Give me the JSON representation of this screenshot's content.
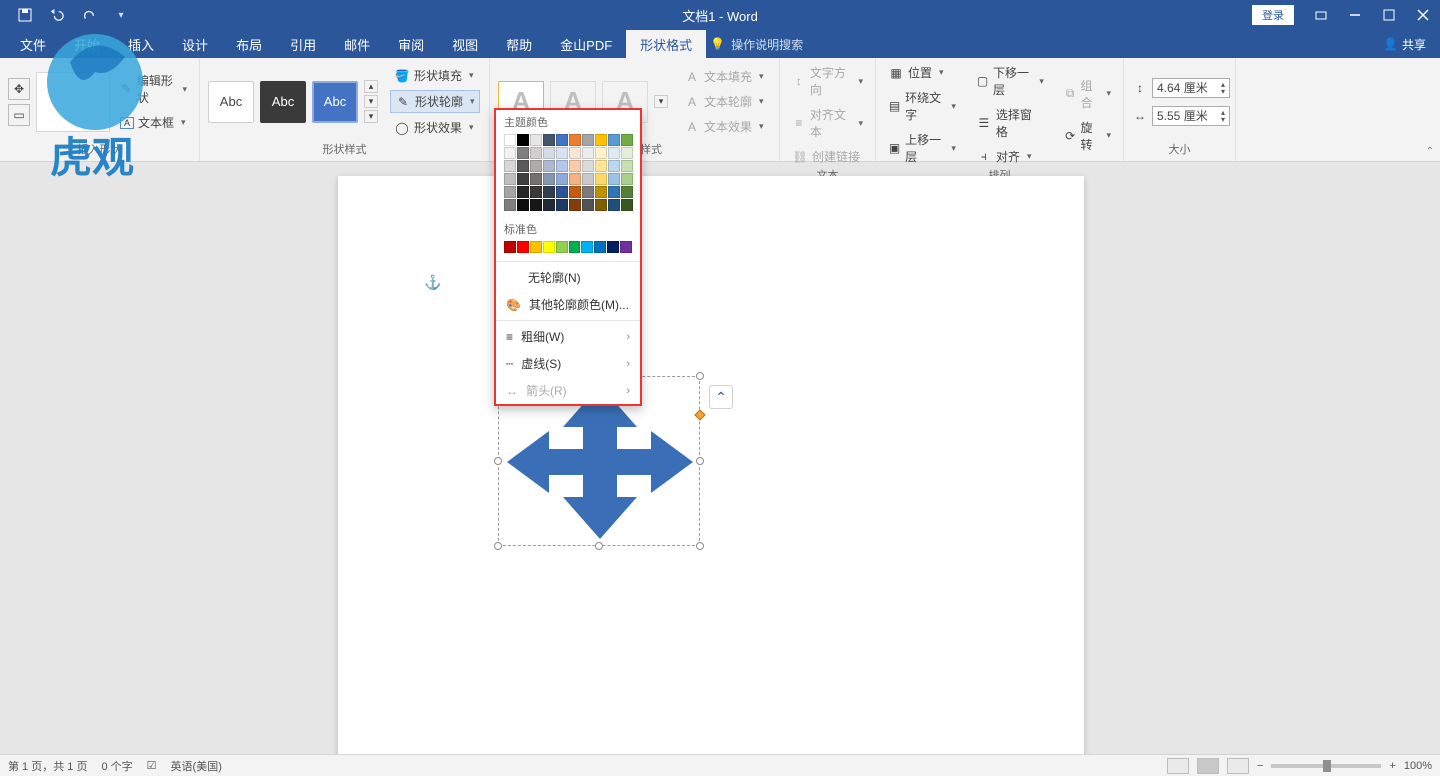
{
  "titlebar": {
    "title": "文档1 - Word",
    "login": "登录"
  },
  "menus": {
    "file": "文件",
    "home": "开始",
    "insert": "插入",
    "design": "设计",
    "layout": "布局",
    "references": "引用",
    "mailings": "邮件",
    "review": "审阅",
    "view": "视图",
    "help": "帮助",
    "jspdf": "金山PDF",
    "shapeformat": "形状格式",
    "tellme": "操作说明搜索",
    "share": "共享"
  },
  "ribbon": {
    "insert_shapes": {
      "edit": "编辑形状",
      "textbox": "文本框",
      "group": "插入形状"
    },
    "shape_styles": {
      "abc": "Abc",
      "fill": "形状填充",
      "outline": "形状轮廓",
      "effects": "形状效果",
      "group": "形状样式"
    },
    "wordart": {
      "group": "艺术字样式",
      "textfill": "文本填充",
      "textoutline": "文本轮廓",
      "texteffects": "文本效果"
    },
    "text": {
      "direction": "文字方向",
      "align": "对齐文本",
      "link": "创建链接",
      "group": "文本"
    },
    "arrange": {
      "pos": "位置",
      "wrap": "环绕文字",
      "forward": "上移一层",
      "backward": "下移一层",
      "pane": "选择窗格",
      "alignobj": "对齐",
      "groupobj": "组合",
      "rotate": "旋转",
      "group": "排列"
    },
    "size": {
      "height": "4.64 厘米",
      "width": "5.55 厘米",
      "group": "大小"
    }
  },
  "outline_panel": {
    "theme": "主题颜色",
    "standard": "标准色",
    "none": "无轮廓(N)",
    "more": "其他轮廓颜色(M)...",
    "weight": "粗细(W)",
    "dashes": "虚线(S)",
    "arrows": "箭头(R)"
  },
  "theme_colors": [
    [
      "#ffffff",
      "#000000",
      "#e7e6e6",
      "#44546a",
      "#4472c4",
      "#ed7d31",
      "#a5a5a5",
      "#ffc000",
      "#5b9bd5",
      "#70ad47"
    ],
    [
      "#f2f2f2",
      "#7f7f7f",
      "#d0cece",
      "#d6dce4",
      "#d9e2f3",
      "#fbe5d5",
      "#ededed",
      "#fff2cc",
      "#deebf6",
      "#e2efd9"
    ],
    [
      "#d8d8d8",
      "#595959",
      "#aeabab",
      "#adb9ca",
      "#b4c6e7",
      "#f7cbac",
      "#dbdbdb",
      "#fee599",
      "#bdd7ee",
      "#c5e0b3"
    ],
    [
      "#bfbfbf",
      "#3f3f3f",
      "#757070",
      "#8496b0",
      "#8eaadb",
      "#f4b183",
      "#c9c9c9",
      "#ffd965",
      "#9cc3e5",
      "#a8d08d"
    ],
    [
      "#a5a5a5",
      "#262626",
      "#3a3838",
      "#323f4f",
      "#2f5496",
      "#c55a11",
      "#7b7b7b",
      "#bf9000",
      "#2e75b5",
      "#538135"
    ],
    [
      "#7f7f7f",
      "#0c0c0c",
      "#171616",
      "#222a35",
      "#1f3864",
      "#833c0b",
      "#525252",
      "#7f6000",
      "#1e4e79",
      "#375623"
    ]
  ],
  "standard_colors": [
    "#c00000",
    "#ff0000",
    "#ffc000",
    "#ffff00",
    "#92d050",
    "#00b050",
    "#00b0f0",
    "#0070c0",
    "#002060",
    "#7030a0"
  ],
  "status": {
    "page": "第 1 页，共 1 页",
    "words": "0 个字",
    "lang": "英语(美国)",
    "zoom": "100%"
  },
  "watermark": "虎观"
}
